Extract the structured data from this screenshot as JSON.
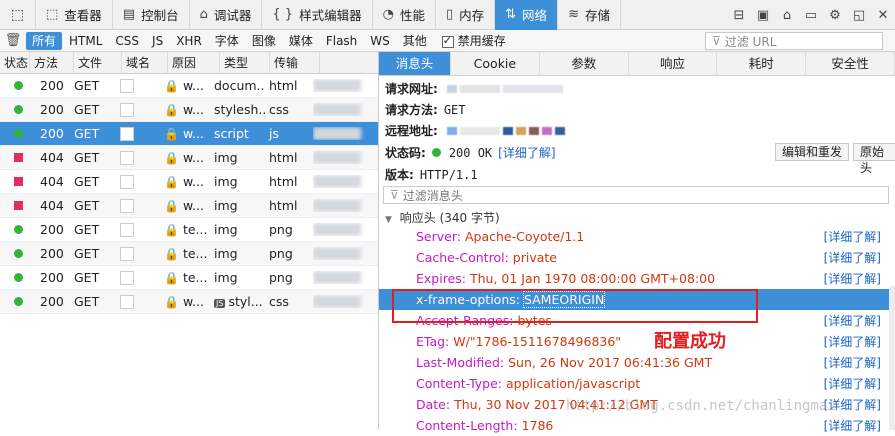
{
  "toolbar": {
    "tabs": [
      {
        "icon": "⬚",
        "label": "查看器"
      },
      {
        "icon": "▤",
        "label": "控制台"
      },
      {
        "icon": "⌂",
        "label": "调试器"
      },
      {
        "icon": "{ }",
        "label": "样式编辑器"
      },
      {
        "icon": "◔",
        "label": "性能"
      },
      {
        "icon": "▯",
        "label": "内存"
      },
      {
        "icon": "⇅",
        "label": "网络"
      },
      {
        "icon": "≋",
        "label": "存储"
      }
    ],
    "active_tab": "网络"
  },
  "filterbar": {
    "types": [
      "所有",
      "HTML",
      "CSS",
      "JS",
      "XHR",
      "字体",
      "图像",
      "媒体",
      "Flash",
      "WS",
      "其他"
    ],
    "active_type": "所有",
    "disable_cache_label": "禁用缓存",
    "filter_url_placeholder": "过滤 URL"
  },
  "request_columns": [
    "状态",
    "方法",
    "文件",
    "域名",
    "原因",
    "类型",
    "传输"
  ],
  "requests": [
    {
      "status": "200",
      "method": "GET",
      "domain": "w...",
      "cause": "docum...",
      "type": "html"
    },
    {
      "status": "200",
      "method": "GET",
      "domain": "w...",
      "cause": "stylesh...",
      "type": "css"
    },
    {
      "status": "200",
      "method": "GET",
      "domain": "w...",
      "cause": "script",
      "type": "js"
    },
    {
      "status": "404",
      "method": "GET",
      "domain": "w...",
      "cause": "img",
      "type": "html"
    },
    {
      "status": "404",
      "method": "GET",
      "domain": "w...",
      "cause": "img",
      "type": "html"
    },
    {
      "status": "404",
      "method": "GET",
      "domain": "w...",
      "cause": "img",
      "type": "html"
    },
    {
      "status": "200",
      "method": "GET",
      "domain": "te...",
      "cause": "img",
      "type": "png"
    },
    {
      "status": "200",
      "method": "GET",
      "domain": "te...",
      "cause": "img",
      "type": "png"
    },
    {
      "status": "200",
      "method": "GET",
      "domain": "te...",
      "cause": "img",
      "type": "png"
    },
    {
      "status": "200",
      "method": "GET",
      "domain": "w...",
      "cause": "styl...",
      "type": "css"
    }
  ],
  "detail_tabs": [
    "消息头",
    "Cookie",
    "参数",
    "响应",
    "耗时",
    "安全性"
  ],
  "details": {
    "request_url_label": "请求网址:",
    "request_method_label": "请求方法:",
    "request_method": "GET",
    "remote_addr_label": "远程地址:",
    "status_label": "状态码:",
    "status_value": "200 OK",
    "learn_more": "[详细了解]",
    "version_label": "版本:",
    "version_value": "HTTP/1.1",
    "edit_resend": "编辑和重发",
    "raw_headers": "原始头",
    "header_filter_placeholder": "过滤消息头",
    "response_section": "响应头 (340 字节)"
  },
  "response_headers": [
    {
      "name": "Server:",
      "value": "Apache-Coyote/1.1"
    },
    {
      "name": "Cache-Control:",
      "value": "private"
    },
    {
      "name": "Expires:",
      "value": "Thu, 01 Jan 1970 08:00:00 GMT+08:00"
    },
    {
      "name": "x-frame-options:",
      "value": "SAMEORIGIN"
    },
    {
      "name": "Accept-Ranges:",
      "value": "bytes"
    },
    {
      "name": "ETag:",
      "value": "W/\"1786-1511678496836\""
    },
    {
      "name": "Last-Modified:",
      "value": "Sun, 26 Nov 2017 06:41:36 GMT"
    },
    {
      "name": "Content-Type:",
      "value": "application/javascript"
    },
    {
      "name": "Date:",
      "value": "Thu, 30 Nov 2017 04:41:12 GMT"
    },
    {
      "name": "Content-Length:",
      "value": "1786"
    }
  ],
  "annotation": "配置成功",
  "watermark": "http://blog.csdn.net/chanlingmai",
  "colors": {
    "accent": "#3d8fd7",
    "ok": "#34b33a",
    "error": "#e0305a",
    "header_name": "#c41ac4",
    "header_value": "#d2380e",
    "annotation": "#e02020"
  }
}
